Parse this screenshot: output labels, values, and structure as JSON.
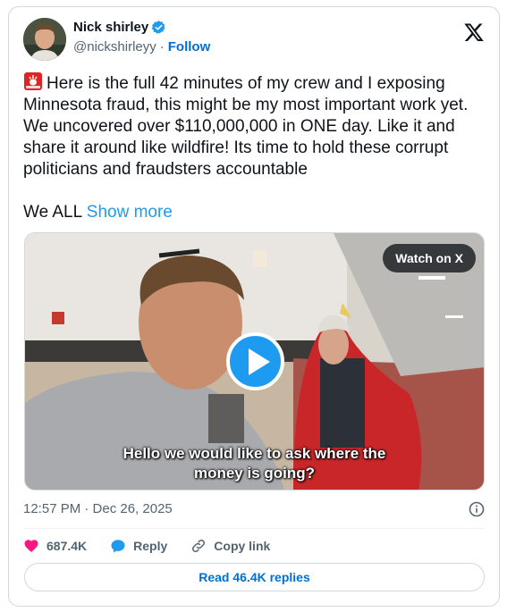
{
  "author": {
    "name": "Nick shirley",
    "handle": "@nickshirleyy",
    "separator": "·",
    "follow_label": "Follow"
  },
  "tweet": {
    "text": "Here is the full 42 minutes of my crew and I exposing Minnesota fraud, this might be my most important work yet. We uncovered over $110,000,000 in ONE day. Like it and share it around like wildfire! Its time to hold these corrupt politicians and fraudsters accountable",
    "text_tail": "We ALL",
    "show_more_label": "Show more"
  },
  "media": {
    "watch_label": "Watch on X",
    "caption_line1": "Hello we would like to ask where the",
    "caption_line2": "money is going?"
  },
  "timestamp": "12:57 PM · Dec 26, 2025",
  "actions": {
    "likes_count": "687.4K",
    "reply_label": "Reply",
    "copy_link_label": "Copy link"
  },
  "read_replies_label": "Read 46.4K replies",
  "colors": {
    "accent": "#1d9bf0",
    "like": "#f91880",
    "link": "#006fd6",
    "muted": "#536471"
  }
}
